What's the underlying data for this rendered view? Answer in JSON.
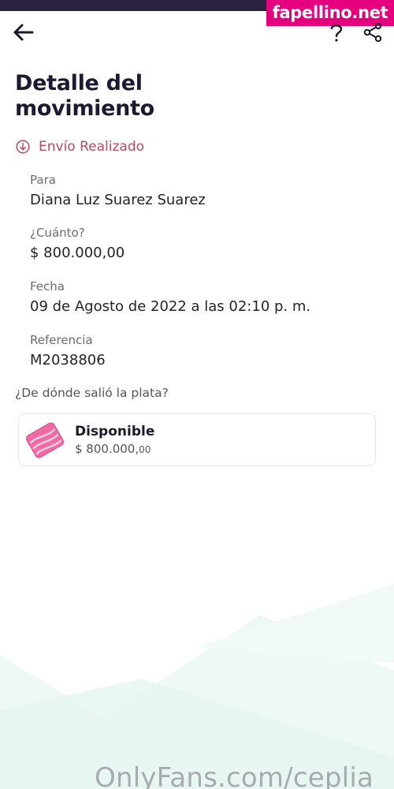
{
  "watermarks": {
    "top": "fapellino.net",
    "bottom": "OnlyFans.com/ceplia"
  },
  "header": {
    "back_icon": "arrow-left-icon",
    "help_icon": "question-icon",
    "share_icon": "share-icon"
  },
  "page": {
    "title": "Detalle del movimiento",
    "status_icon": "arrow-down-circle-icon",
    "status": "Envío Realizado",
    "status_color": "#c0495b"
  },
  "details": [
    {
      "label": "Para",
      "value": "Diana Luz Suarez Suarez"
    },
    {
      "label": "¿Cuánto?",
      "value": "$ 800.000,00"
    },
    {
      "label": "Fecha",
      "value": "09 de Agosto de 2022 a las 02:10 p. m."
    },
    {
      "label": "Referencia",
      "value": "M2038806"
    }
  ],
  "source": {
    "question": "¿De dónde salió la plata?",
    "card": {
      "icon": "pocket-icon",
      "title": "Disponible",
      "amount_main": "$ 800.000,",
      "amount_cents": "00"
    }
  },
  "colors": {
    "status_bar": "#2b2140",
    "title": "#1c1a33",
    "watermark_pink": "#e5007d",
    "pocket_pink": "#f06aa6"
  }
}
